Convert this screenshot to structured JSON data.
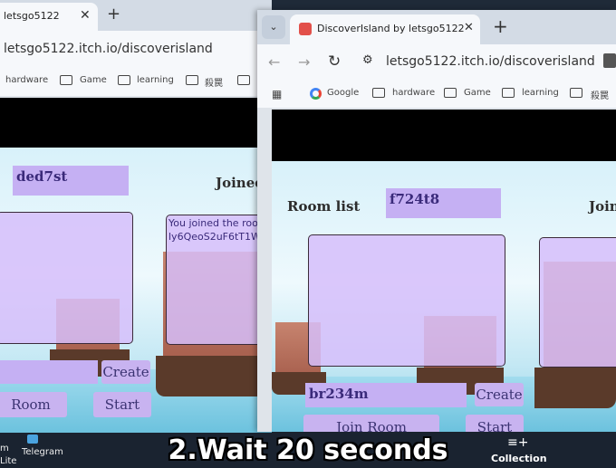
{
  "back_window": {
    "tab_title": "letsgo5122",
    "url": "letsgo5122.itch.io/discoverisland",
    "bookmarks": [
      "hardware",
      "Game",
      "learning",
      "殺罠"
    ],
    "room_code": "ded7st",
    "joined_heading": "Joined",
    "message_line1": "You joined the room",
    "message_line2": "ly6QeoS2uF6tT1W",
    "create_label": "Create",
    "join_room_label": "Room",
    "start_label": "Start"
  },
  "front_window": {
    "tab_title": "DiscoverIsland by letsgo5122",
    "url": "letsgo5122.itch.io/discoverisland",
    "bookmarks": [
      "Google",
      "hardware",
      "Game",
      "learning",
      "殺罠"
    ],
    "room_list_heading": "Room list",
    "room_code": "f724t8",
    "joined_heading": "Join",
    "name_input_value": "br234m",
    "create_label": "Create",
    "join_room_label": "Join Room",
    "start_label": "Start"
  },
  "taskbar": {
    "left_label_1": "m",
    "left_label_2": "Lite",
    "telegram_label": "Telegram",
    "collection_label": "Collection"
  },
  "caption": "2.Wait 20 seconds",
  "colors": {
    "panel": "#d6befa",
    "field": "#c5b0f3",
    "button_text": "#3b3372",
    "titlebar": "#d3dbe5"
  }
}
